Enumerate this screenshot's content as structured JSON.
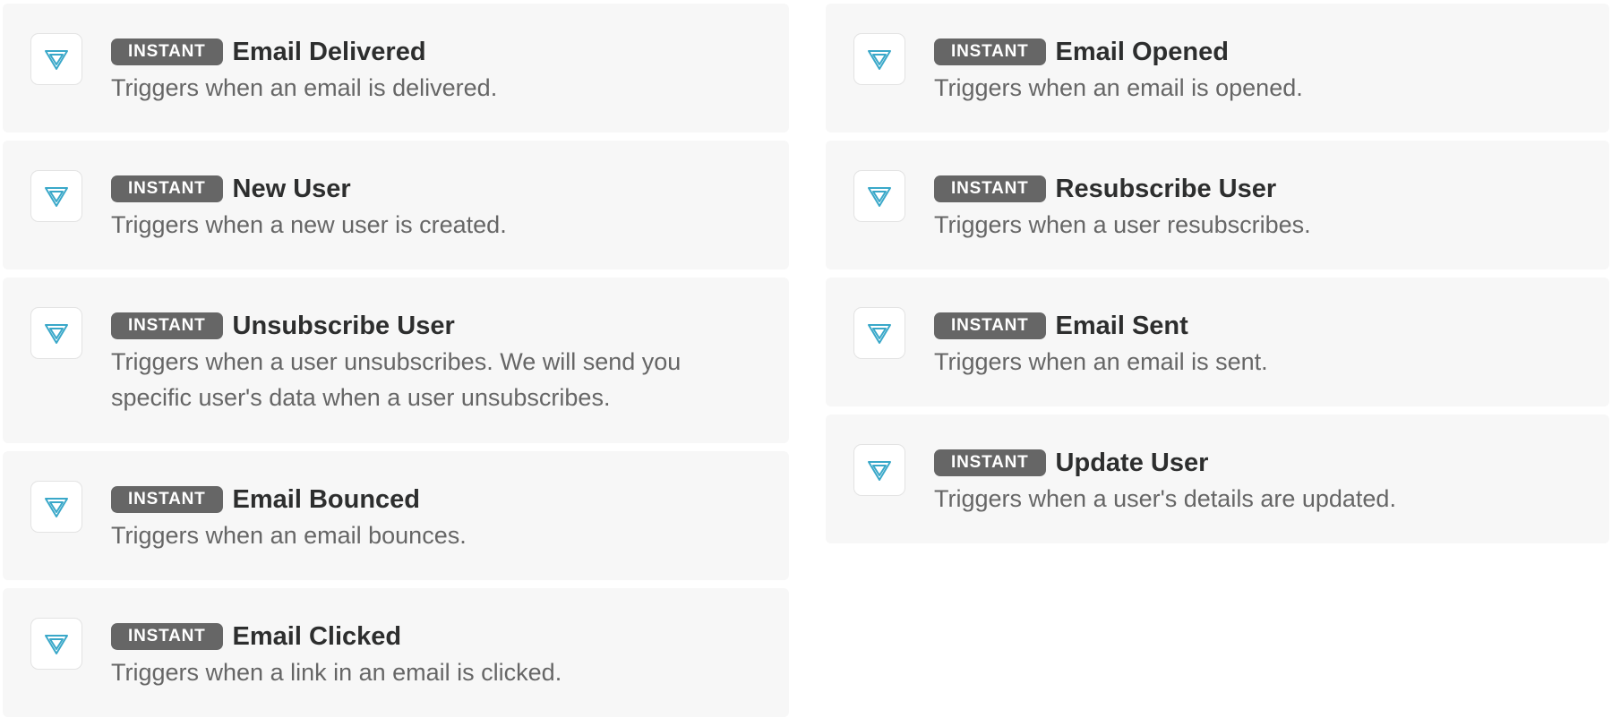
{
  "badge_label": "INSTANT",
  "icon_name": "app-logo-icon",
  "accent_color": "#3aa8c9",
  "triggers_left": [
    {
      "title": "Email Delivered",
      "description": "Triggers when an email is delivered."
    },
    {
      "title": "New User",
      "description": "Triggers when a new user is created."
    },
    {
      "title": "Unsubscribe User",
      "description": "Triggers when a user unsubscribes. We will send you specific user's data when a user unsubscribes."
    },
    {
      "title": "Email Bounced",
      "description": "Triggers when an email bounces."
    },
    {
      "title": "Email Clicked",
      "description": "Triggers when a link in an email is clicked."
    }
  ],
  "triggers_right": [
    {
      "title": "Email Opened",
      "description": "Triggers when an email is opened."
    },
    {
      "title": "Resubscribe User",
      "description": "Triggers when a user resubscribes."
    },
    {
      "title": "Email Sent",
      "description": "Triggers when an email is sent."
    },
    {
      "title": "Update User",
      "description": "Triggers when a user's details are updated."
    }
  ]
}
